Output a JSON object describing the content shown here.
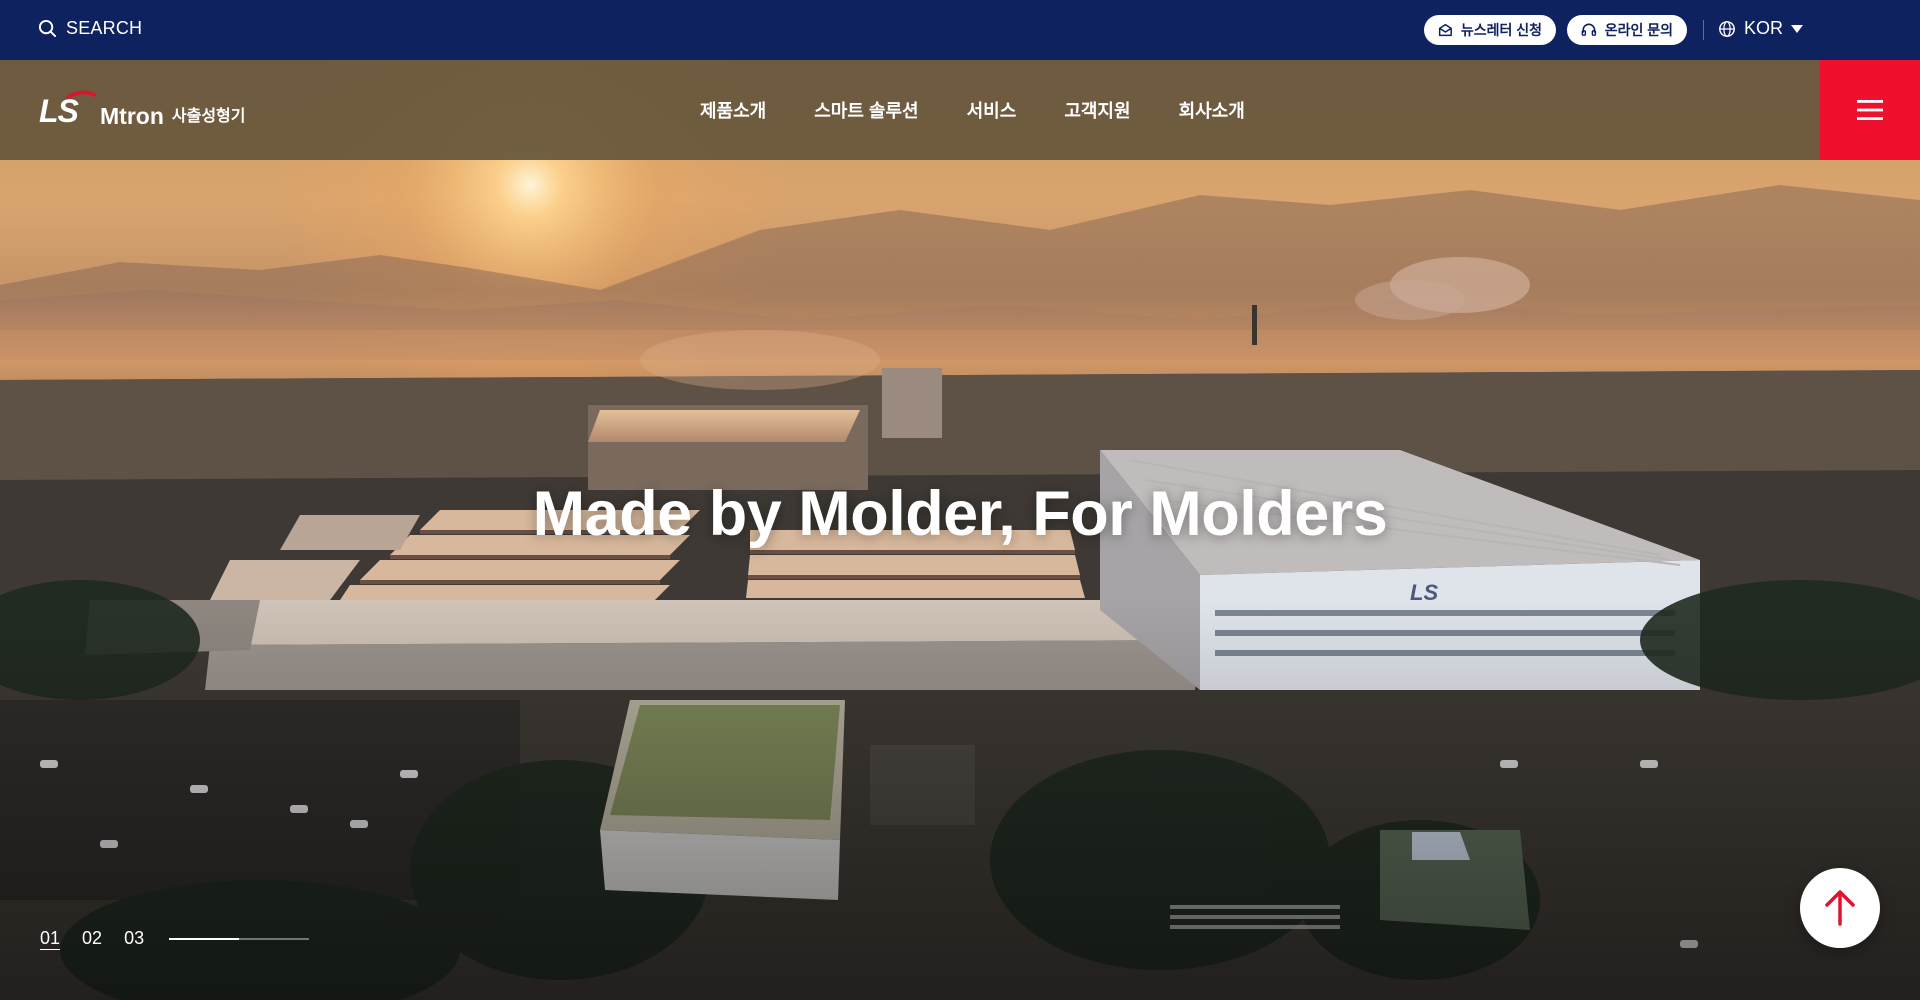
{
  "topbar": {
    "search_label": "SEARCH",
    "newsletter_label": "뉴스레터 신청",
    "inquiry_label": "온라인 문의",
    "language_label": "KOR"
  },
  "header": {
    "logo_mark": "LS",
    "logo_brand": "Mtron",
    "logo_sub": "사출성형기",
    "nav": [
      "제품소개",
      "스마트 솔루션",
      "서비스",
      "고객지원",
      "회사소개"
    ],
    "menu_icon": "hamburger-icon"
  },
  "hero": {
    "title": "Made by Molder, For Molders",
    "slides": [
      "01",
      "02",
      "03"
    ],
    "active_slide": "01",
    "progress": 0.5
  },
  "colors": {
    "topbar_bg": "#0f2260",
    "header_bg": "#66563c",
    "accent_red": "#f0102e"
  }
}
